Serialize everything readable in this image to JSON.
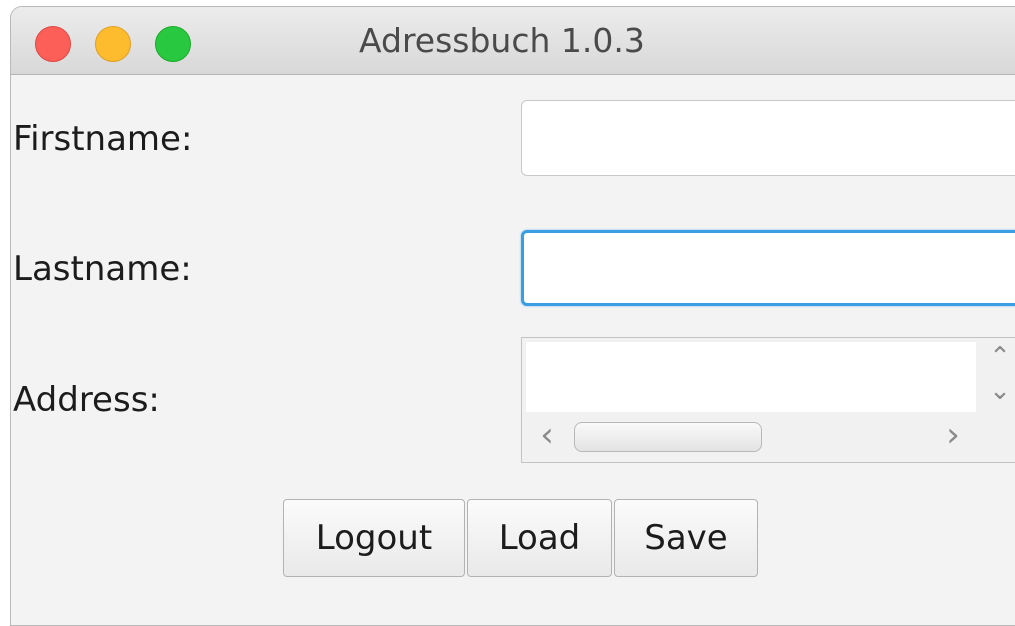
{
  "window": {
    "title": "Adressbuch 1.0.3"
  },
  "form": {
    "firstname_label": "Firstname:",
    "firstname_value": "",
    "lastname_label": "Lastname:",
    "lastname_value": "",
    "address_label": "Address:",
    "address_value": ""
  },
  "scroll": {
    "up_arrow": "⌃",
    "down_arrow": "⌄",
    "left_arrow": "‹",
    "right_arrow": "›"
  },
  "buttons": {
    "logout_label": "Logout",
    "load_label": "Load",
    "save_label": "Save"
  },
  "colors": {
    "close": "#fc5f57",
    "minimize": "#fdbc2e",
    "zoom": "#28c840",
    "focus_ring": "#3a9ee3"
  }
}
